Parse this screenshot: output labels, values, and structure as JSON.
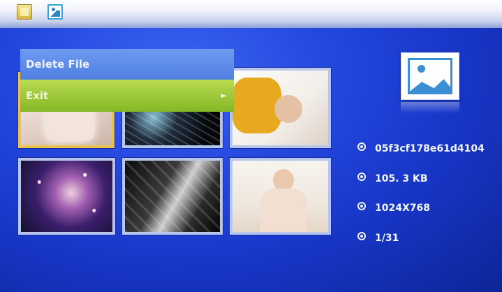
{
  "toolbar": {
    "file_icon": "file-folder-icon",
    "photo_icon": "photo-mode-icon"
  },
  "menu": {
    "items": [
      {
        "label": "Delete File"
      },
      {
        "label": "Exit",
        "arrow": "►"
      }
    ]
  },
  "thumbnails": [
    {
      "name": "photo-1",
      "selected": true
    },
    {
      "name": "photo-2",
      "selected": false
    },
    {
      "name": "photo-3",
      "selected": false
    },
    {
      "name": "photo-4",
      "selected": false
    },
    {
      "name": "photo-5",
      "selected": false
    },
    {
      "name": "photo-6",
      "selected": false
    }
  ],
  "info": {
    "icon": "image-icon",
    "filename": "05f3cf178e61d4104",
    "size": "105. 3 KB",
    "resolution": "1024X768",
    "position": "1/31"
  },
  "colors": {
    "background": "#2346dd",
    "menu_delete": "#5a88e8",
    "menu_exit": "#9cc83a",
    "selection": "#e8c24a"
  }
}
